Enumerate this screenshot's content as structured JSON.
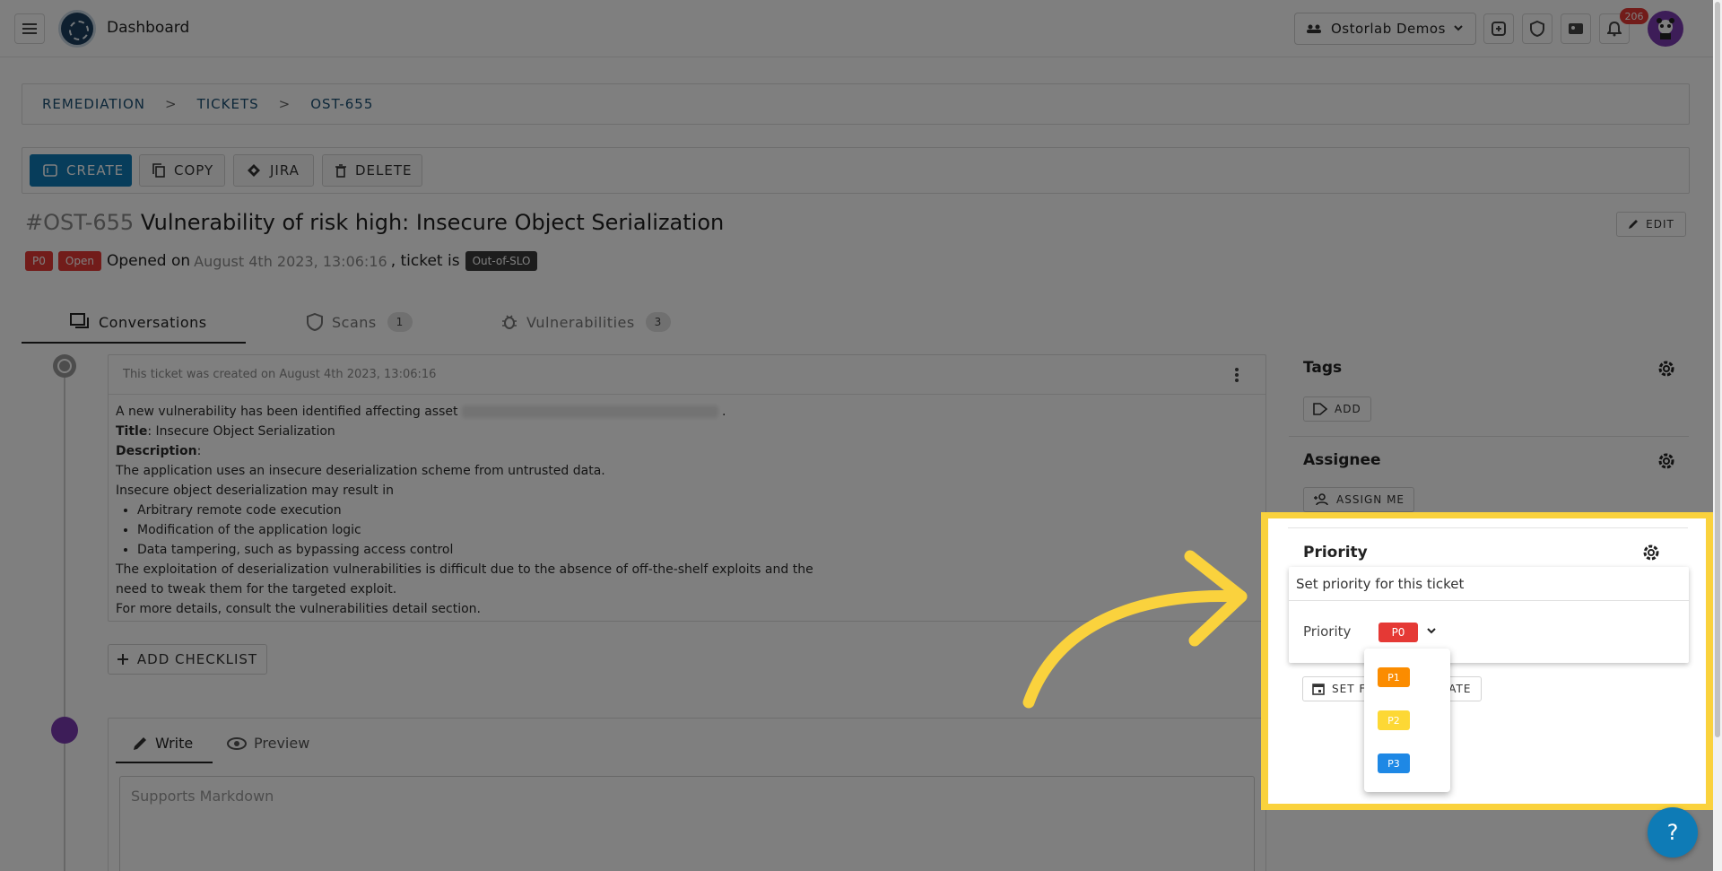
{
  "header": {
    "app_title": "Dashboard",
    "org_name": "Ostorlab Demos",
    "notification_count": "206"
  },
  "breadcrumb": [
    "REMEDIATION",
    "TICKETS",
    "OST-655"
  ],
  "breadcrumb_sep": ">",
  "actions": {
    "create": "CREATE",
    "copy": "COPY",
    "jira": "JIRA",
    "delete": "DELETE",
    "edit": "EDIT"
  },
  "ticket": {
    "id": "#OST-655",
    "title": "Vulnerability of risk high: Insecure Object Serialization",
    "priority": "P0",
    "status": "Open",
    "opened_prefix": "Opened on",
    "opened_date": "August 4th 2023, 13:06:16",
    "ticket_is": ", ticket is",
    "slo": "Out-of-SLO"
  },
  "tabs": [
    {
      "label": "Conversations"
    },
    {
      "label": "Scans",
      "count": "1"
    },
    {
      "label": "Vulnerabilities",
      "count": "3"
    }
  ],
  "message": {
    "header": "This ticket was created on August 4th 2023, 13:06:16",
    "intro": "A new vulnerability has been identified affecting asset",
    "intro_end": ".",
    "title_label": "Title",
    "title_value": ": Insecure Object Serialization",
    "desc_label": "Description",
    "desc_colon": ":",
    "line1": "The application uses an insecure deserialization scheme from untrusted data.",
    "line2": "Insecure object deserialization may result in",
    "bullets": [
      "Arbitrary remote code execution",
      "Modification of the application logic",
      "Data tampering, such as bypassing access control"
    ],
    "line3": "The exploitation of deserialization vulnerabilities is difficult due to the absence of off-the-shelf exploits and the",
    "line4": "need to tweak them for the targeted exploit.",
    "line5": "For more details, consult the vulnerabilities detail section."
  },
  "add_checklist": "ADD CHECKLIST",
  "comment": {
    "write": "Write",
    "preview": "Preview",
    "placeholder": "Supports Markdown"
  },
  "side": {
    "tags_title": "Tags",
    "tags_btn": "ADD",
    "assignee_title": "Assignee",
    "assignee_btn": "ASSIGN ME",
    "priority_title": "Priority",
    "popover_head": "Set priority for this ticket",
    "priority_label": "Priority",
    "priority_value": "P0",
    "set_date_left": "SET F",
    "set_date_right": "ATE",
    "options": [
      "P1",
      "P2",
      "P3"
    ]
  },
  "help": "?",
  "colors": {
    "primary": "#0e7bb6",
    "p0": "#e53935",
    "p1": "#fb8c00",
    "p2": "#fdd835",
    "p3": "#1e88e5",
    "highlight": "#fad23d"
  }
}
